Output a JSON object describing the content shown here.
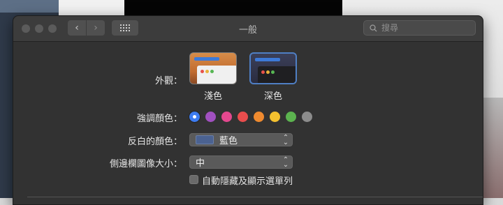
{
  "window": {
    "title": "一般"
  },
  "search": {
    "placeholder": "搜尋"
  },
  "appearance": {
    "label": "外觀：",
    "options": [
      {
        "label": "淺色"
      },
      {
        "label": "深色"
      }
    ],
    "selected": "深色"
  },
  "accent": {
    "label": "強調顏色：",
    "colors": [
      "#3d7cf1",
      "#a150c0",
      "#e4488f",
      "#ea4d4d",
      "#ef8a2f",
      "#f4c12f",
      "#5cb34f",
      "#8c8c8c"
    ],
    "selected_index": 0
  },
  "highlight": {
    "label": "反白的顏色：",
    "value": "藍色"
  },
  "sidebar_icon": {
    "label": "側邊欄圖像大小：",
    "value": "中"
  },
  "menu_bar": {
    "label": "自動隱藏及顯示選單列",
    "checked": false
  }
}
